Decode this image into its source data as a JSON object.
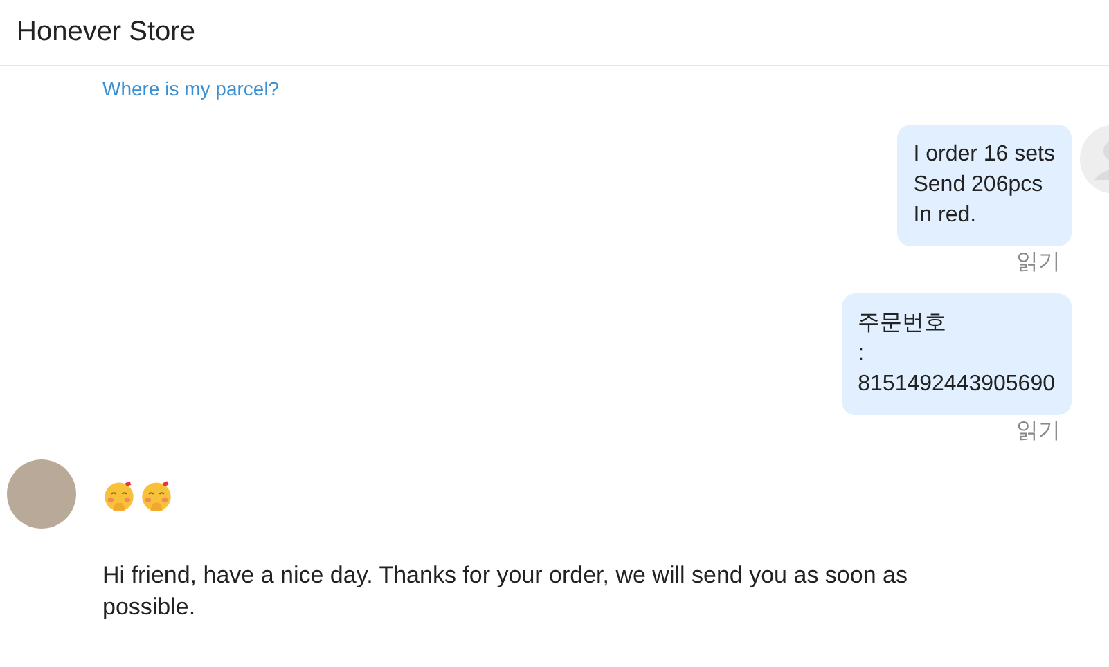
{
  "header": {
    "title": "Honever Store"
  },
  "messages": [
    {
      "kind": "links",
      "links": [
        "Where is my parcel?"
      ]
    },
    {
      "kind": "outgoing",
      "show_avatar": true,
      "lines": [
        "I order 16 sets",
        "Send 206pcs",
        "In red."
      ],
      "status": "읽기"
    },
    {
      "kind": "outgoing",
      "show_avatar": false,
      "lines": [
        "주문번호",
        ":",
        "8151492443905690"
      ],
      "status": "읽기"
    },
    {
      "kind": "stickers",
      "show_avatar": true,
      "stickers": [
        {
          "kind": "blush"
        },
        {
          "kind": "blush"
        }
      ]
    },
    {
      "kind": "incoming_text",
      "show_avatar": false,
      "text": "Hi friend, have a nice day. Thanks for your order, we will send you as soon as possible."
    }
  ]
}
